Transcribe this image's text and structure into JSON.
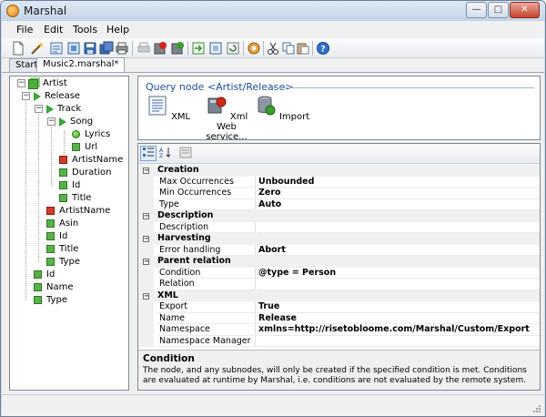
{
  "window": {
    "title": "Marshal",
    "minimize": "—",
    "maximize": "□",
    "close": "✕"
  },
  "menu": {
    "items": [
      {
        "label": "File",
        "icon": ""
      },
      {
        "label": "Edit",
        "icon": ""
      },
      {
        "label": "Tools",
        "icon": ""
      },
      {
        "label": "Help",
        "icon": ""
      }
    ]
  },
  "toolbar": {
    "buttons": [
      "new-icon",
      "wizard-icon",
      "open-icon",
      "open-folder-icon",
      "save-icon",
      "save-all-icon",
      "print-icon",
      "disabled-print-icon",
      "record-icon",
      "record-alt-icon",
      "export-icon",
      "import-icon",
      "refresh-icon",
      "settings-icon",
      "cut-icon",
      "copy-icon",
      "paste-icon",
      "help-icon"
    ]
  },
  "tabs": [
    {
      "label": "Start",
      "active": false
    },
    {
      "label": "Music2.marshal*",
      "active": true
    }
  ],
  "tree": {
    "items": [
      {
        "label": "Artist",
        "icon": "stack"
      },
      {
        "label": "Release",
        "icon": "triangle"
      },
      {
        "label": "Track",
        "icon": "triangle"
      },
      {
        "label": "Song",
        "icon": "triangle"
      },
      {
        "label": "Lyrics",
        "icon": "dot"
      },
      {
        "label": "Url",
        "icon": "green"
      },
      {
        "label": "ArtistName",
        "icon": "red"
      },
      {
        "label": "Duration",
        "icon": "green"
      },
      {
        "label": "Id",
        "icon": "green"
      },
      {
        "label": "Title",
        "icon": "green"
      },
      {
        "label": "ArtistName",
        "icon": "red"
      },
      {
        "label": "Asin",
        "icon": "green"
      },
      {
        "label": "Id",
        "icon": "green"
      },
      {
        "label": "Title",
        "icon": "green"
      },
      {
        "label": "Type",
        "icon": "green"
      },
      {
        "label": "Id",
        "icon": "green"
      },
      {
        "label": "Name",
        "icon": "green"
      },
      {
        "label": "Type",
        "icon": "green"
      }
    ]
  },
  "query_node": {
    "title": "Query node <Artist/Release>",
    "actions": [
      {
        "label": "XML",
        "icon": "xml-icon"
      },
      {
        "label": "Xml Web service...",
        "icon": "web-service-icon"
      },
      {
        "label": "Import",
        "icon": "import-db-icon"
      }
    ]
  },
  "properties": {
    "rows": [
      {
        "kind": "category",
        "name": "Creation",
        "value": ""
      },
      {
        "kind": "prop",
        "name": "Max Occurrences",
        "value": "Unbounded"
      },
      {
        "kind": "prop",
        "name": "Min Occurrences",
        "value": "Zero"
      },
      {
        "kind": "prop",
        "name": "Type",
        "value": "Auto"
      },
      {
        "kind": "category",
        "name": "Description",
        "value": ""
      },
      {
        "kind": "prop",
        "name": "Description",
        "value": ""
      },
      {
        "kind": "category",
        "name": "Harvesting",
        "value": ""
      },
      {
        "kind": "prop",
        "name": "Error handling",
        "value": "Abort"
      },
      {
        "kind": "category",
        "name": "Parent relation",
        "value": ""
      },
      {
        "kind": "prop",
        "name": "Condition",
        "value": "@type = Person"
      },
      {
        "kind": "prop",
        "name": "Relation",
        "value": ""
      },
      {
        "kind": "category",
        "name": "XML",
        "value": ""
      },
      {
        "kind": "prop",
        "name": "Export",
        "value": "True"
      },
      {
        "kind": "prop",
        "name": "Name",
        "value": "Release"
      },
      {
        "kind": "prop",
        "name": "Namespace",
        "value": "xmlns=http://risetobloome.com/Marshal/Custom/Export"
      },
      {
        "kind": "prop",
        "name": "Namespace Manager",
        "value": ""
      }
    ],
    "description": {
      "title": "Condition",
      "text": "The node, and any subnodes, will only be created if the specified condition is met. Conditions are evaluated at runtime by Marshal, i.e. conditions are not evaluated by the remote system."
    }
  }
}
